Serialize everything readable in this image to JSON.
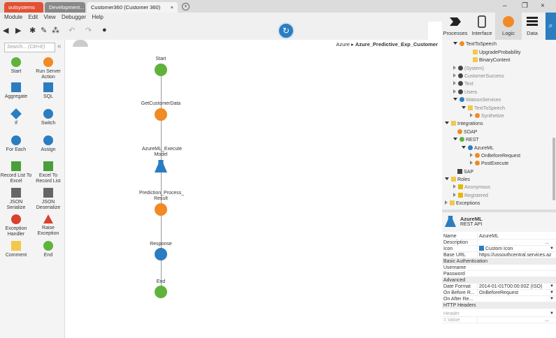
{
  "titlebar": {
    "tabs": [
      {
        "label": "outsystems"
      },
      {
        "label": "Development..."
      },
      {
        "label": "Customer360 (Customer 360)"
      }
    ],
    "close_glyph": "×",
    "new_tab_glyph": "+",
    "window_controls": {
      "minimize": "–",
      "restore": "❐",
      "close": "×"
    }
  },
  "menu": [
    "Module",
    "Edit",
    "View",
    "Debugger",
    "Help"
  ],
  "right_tabs": [
    {
      "label": "Processes",
      "icon": "processes-icon"
    },
    {
      "label": "Interface",
      "icon": "interface-icon"
    },
    {
      "label": "Logic",
      "icon": "logic-icon",
      "active": true
    },
    {
      "label": "Data",
      "icon": "data-icon"
    }
  ],
  "toolbox": {
    "search_placeholder": "Search... (Ctrl+E)",
    "collapse_glyph": "«",
    "items": [
      {
        "label": "Start"
      },
      {
        "label": "Run Server Action"
      },
      {
        "label": "Aggregate"
      },
      {
        "label": "SQL"
      },
      {
        "label": "If"
      },
      {
        "label": "Switch"
      },
      {
        "label": "For Each"
      },
      {
        "label": "Assign"
      },
      {
        "label": "Record List To Excel"
      },
      {
        "label": "Excel To Record List"
      },
      {
        "label": "JSON Serialize"
      },
      {
        "label": "JSON Deserialize"
      },
      {
        "label": "Exception Handler"
      },
      {
        "label": "Raise Exception"
      },
      {
        "label": "Comment"
      },
      {
        "label": "End"
      }
    ]
  },
  "canvas": {
    "breadcrumb_parent": "Azure",
    "breadcrumb_sep": "▸",
    "breadcrumb_current": "Azure_Predictive_Exp_Customer",
    "nodes": [
      {
        "label": "Start"
      },
      {
        "label": "GetCustomerData"
      },
      {
        "label": "AzureML_Execute Model"
      },
      {
        "label": "Prediction_Process_ Result"
      },
      {
        "label": "Response"
      },
      {
        "label": "End"
      }
    ]
  },
  "tree": [
    {
      "label": "TextToSpeech"
    },
    {
      "label": "UpgradeProbability"
    },
    {
      "label": "BinaryContent"
    },
    {
      "label": "(System)"
    },
    {
      "label": "CustomerSuccess"
    },
    {
      "label": "Text"
    },
    {
      "label": "Users"
    },
    {
      "label": "WatsonServices"
    },
    {
      "label": "TextToSpeech"
    },
    {
      "label": "Synthetize"
    },
    {
      "label": "Integrations"
    },
    {
      "label": "SOAP"
    },
    {
      "label": "REST"
    },
    {
      "label": "AzureML"
    },
    {
      "label": "OnBeforeRequest"
    },
    {
      "label": "PostExecute"
    },
    {
      "label": "SAP"
    },
    {
      "label": "Roles"
    },
    {
      "label": "Anonymous"
    },
    {
      "label": "Registered"
    },
    {
      "label": "Exceptions"
    }
  ],
  "properties": {
    "title": "AzureML",
    "subtitle": "REST API",
    "rows": [
      {
        "key": "Name",
        "value": "AzureML"
      },
      {
        "key": "Description",
        "value": "..."
      },
      {
        "key": "Icon",
        "value": "Custom Icon"
      },
      {
        "key": "Base URL",
        "value": "https://ussouthcentral.services.azu"
      }
    ],
    "section_auth": "Basic Authentication",
    "auth_rows": [
      {
        "key": "Username",
        "value": ""
      },
      {
        "key": "Password",
        "value": ""
      }
    ],
    "section_adv": "Advanced",
    "adv_rows": [
      {
        "key": "Date Format",
        "value": "2014-01-01T00:00:00Z (ISO)"
      },
      {
        "key": "On Before R...",
        "value": "OnBeforeRequest"
      },
      {
        "key": "On After Re...",
        "value": ""
      }
    ],
    "section_http": "HTTP Headers",
    "header_rows": [
      {
        "key": "Header",
        "value": ""
      },
      {
        "key": "= Value",
        "value": "..."
      }
    ]
  }
}
